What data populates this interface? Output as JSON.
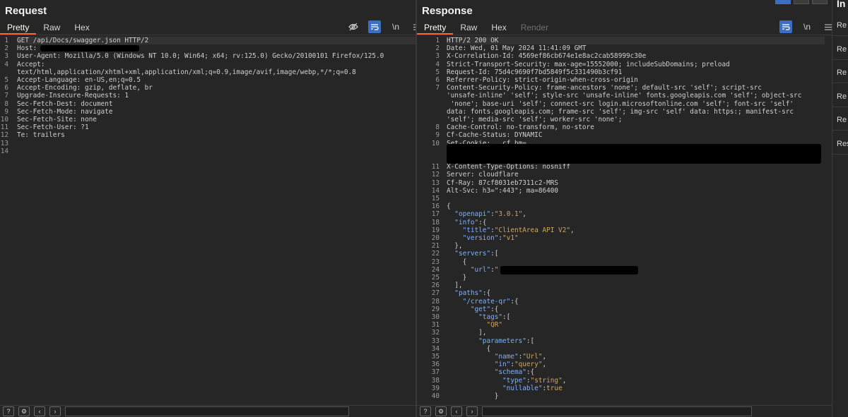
{
  "request": {
    "title": "Request",
    "tabs": [
      "Pretty",
      "Raw",
      "Hex"
    ],
    "lines": [
      {
        "n": "1",
        "t": "GET /api/Docs/swagger.json HTTP/2"
      },
      {
        "n": "2",
        "t": "Host: "
      },
      {
        "n": "3",
        "t": "User-Agent: Mozilla/5.0 (Windows NT 10.0; Win64; x64; rv:125.0) Gecko/20100101 Firefox/125.0"
      },
      {
        "n": "4",
        "t": "Accept:"
      },
      {
        "n": "",
        "t": "text/html,application/xhtml+xml,application/xml;q=0.9,image/avif,image/webp,*/*;q=0.8"
      },
      {
        "n": "5",
        "t": "Accept-Language: en-US,en;q=0.5"
      },
      {
        "n": "6",
        "t": "Accept-Encoding: gzip, deflate, br"
      },
      {
        "n": "7",
        "t": "Upgrade-Insecure-Requests: 1"
      },
      {
        "n": "8",
        "t": "Sec-Fetch-Dest: document"
      },
      {
        "n": "9",
        "t": "Sec-Fetch-Mode: navigate"
      },
      {
        "n": "10",
        "t": "Sec-Fetch-Site: none"
      },
      {
        "n": "11",
        "t": "Sec-Fetch-User: ?1"
      },
      {
        "n": "12",
        "t": "Te: trailers"
      },
      {
        "n": "13",
        "t": ""
      },
      {
        "n": "14",
        "t": ""
      }
    ]
  },
  "response": {
    "title": "Response",
    "tabs": [
      "Pretty",
      "Raw",
      "Hex",
      "Render"
    ],
    "lines": [
      {
        "n": "1",
        "t": "HTTP/2 200 OK"
      },
      {
        "n": "2",
        "t": "Date: Wed, 01 May 2024 11:41:09 GMT"
      },
      {
        "n": "3",
        "t": "X-Correlation-Id: 4569ef86cb674e1e8ac2cab58999c30e"
      },
      {
        "n": "4",
        "t": "Strict-Transport-Security: max-age=15552000; includeSubDomains; preload"
      },
      {
        "n": "5",
        "t": "Request-Id: 75d4c9690f7bd5849f5c331490b3cf91"
      },
      {
        "n": "6",
        "t": "Referrer-Policy: strict-origin-when-cross-origin"
      },
      {
        "n": "7",
        "t": "Content-Security-Policy: frame-ancestors 'none'; default-src 'self'; script-src"
      },
      {
        "n": "",
        "t": "'unsafe-inline' 'self'; style-src 'unsafe-inline' fonts.googleapis.com 'self'; object-src"
      },
      {
        "n": "",
        "t": " 'none'; base-uri 'self'; connect-src login.microsoftonline.com 'self'; font-src 'self'"
      },
      {
        "n": "",
        "t": "data: fonts.googleapis.com; frame-src 'self'; img-src 'self' data: https:; manifest-src"
      },
      {
        "n": "",
        "t": "'self'; media-src 'self'; worker-src 'none';"
      },
      {
        "n": "8",
        "t": "Cache-Control: no-transform, no-store"
      },
      {
        "n": "9",
        "t": "Cf-Cache-Status: DYNAMIC"
      },
      {
        "n": "10",
        "t": "Set-Cookie: __cf_bm="
      },
      {
        "n": "",
        "t": ""
      },
      {
        "n": "",
        "t": ""
      },
      {
        "n": "11",
        "t": "X-Content-Type-Options: nosniff"
      },
      {
        "n": "12",
        "t": "Server: cloudflare"
      },
      {
        "n": "13",
        "t": "Cf-Ray: 87cf8031eb7311c2-MRS"
      },
      {
        "n": "14",
        "t": "Alt-Svc: h3=\":443\"; ma=86400"
      },
      {
        "n": "15",
        "t": ""
      },
      {
        "n": "16",
        "t": "{"
      },
      {
        "n": "17",
        "t": "  \"openapi\":\"3.0.1\","
      },
      {
        "n": "18",
        "t": "  \"info\":{"
      },
      {
        "n": "19",
        "t": "    \"title\":\"ClientArea API V2\","
      },
      {
        "n": "20",
        "t": "    \"version\":\"v1\""
      },
      {
        "n": "21",
        "t": "  },"
      },
      {
        "n": "22",
        "t": "  \"servers\":["
      },
      {
        "n": "23",
        "t": "    {"
      },
      {
        "n": "24",
        "t": "      \"url\":\"                              /api\""
      },
      {
        "n": "25",
        "t": "    }"
      },
      {
        "n": "26",
        "t": "  ],"
      },
      {
        "n": "27",
        "t": "  \"paths\":{"
      },
      {
        "n": "28",
        "t": "    \"/create-qr\":{"
      },
      {
        "n": "29",
        "t": "      \"get\":{"
      },
      {
        "n": "30",
        "t": "        \"tags\":["
      },
      {
        "n": "31",
        "t": "          \"QR\""
      },
      {
        "n": "32",
        "t": "        ],"
      },
      {
        "n": "33",
        "t": "        \"parameters\":["
      },
      {
        "n": "34",
        "t": "          {"
      },
      {
        "n": "35",
        "t": "            \"name\":\"Url\","
      },
      {
        "n": "36",
        "t": "            \"in\":\"query\","
      },
      {
        "n": "37",
        "t": "            \"schema\":{"
      },
      {
        "n": "38",
        "t": "              \"type\":\"string\","
      },
      {
        "n": "39",
        "t": "              \"nullable\":true"
      },
      {
        "n": "40",
        "t": "            }"
      }
    ]
  },
  "side": {
    "title": "In",
    "items": [
      "Re",
      "Re",
      "Re",
      "Re",
      "Re",
      "Res"
    ]
  }
}
